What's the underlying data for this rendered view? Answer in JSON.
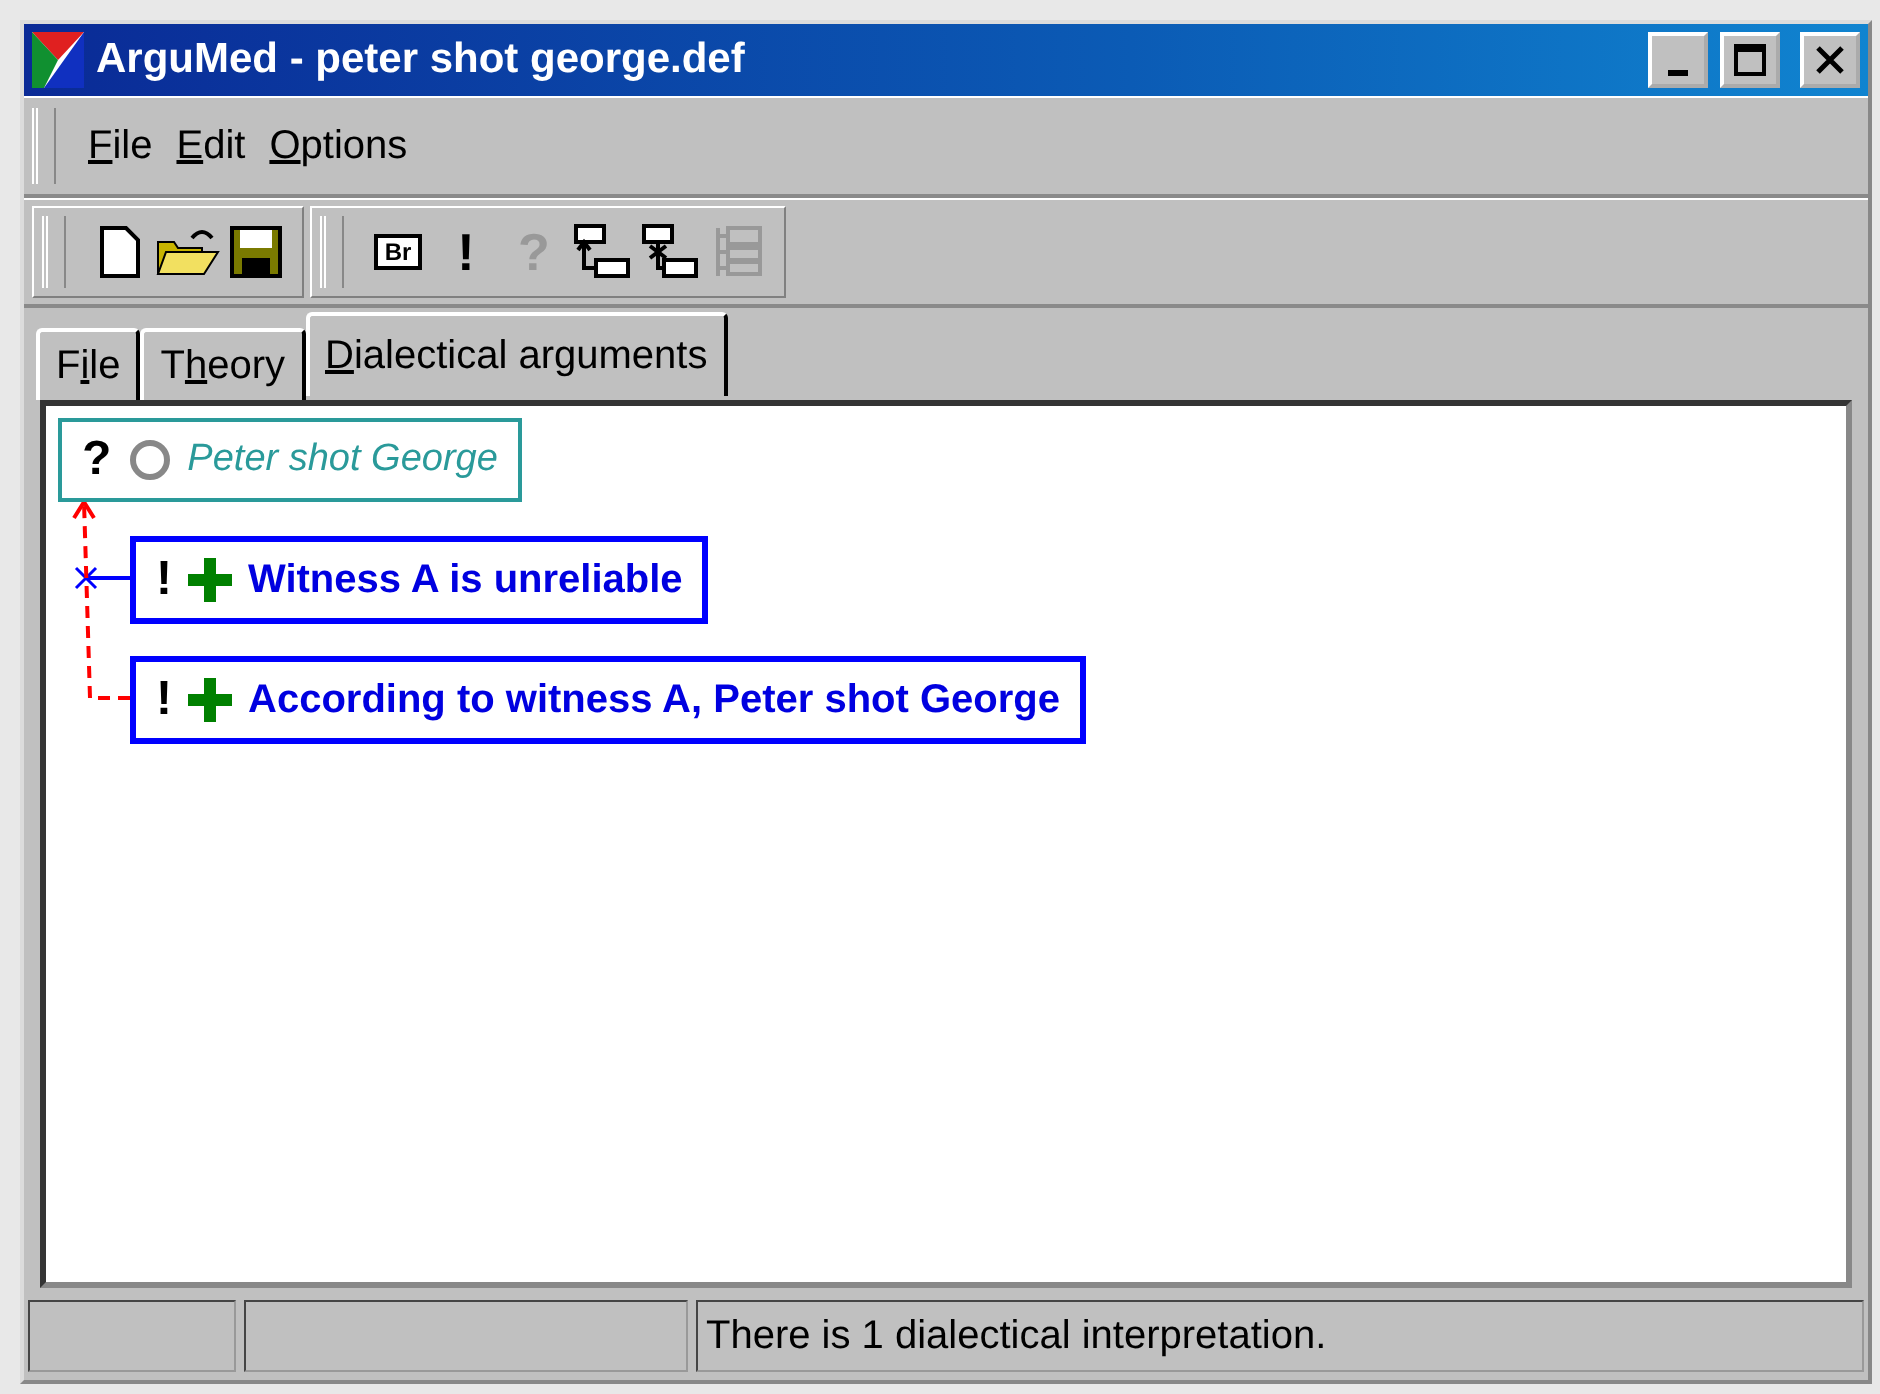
{
  "window": {
    "title": "ArguMed - peter shot george.def"
  },
  "menu": [
    {
      "key": "F",
      "after": "ile"
    },
    {
      "key": "E",
      "after": "dit"
    },
    {
      "key": "O",
      "after": "ptions"
    }
  ],
  "toolbar": [
    {
      "items": [
        {
          "kind": "new",
          "disabled": false
        },
        {
          "kind": "open",
          "disabled": false
        },
        {
          "kind": "save",
          "disabled": false
        }
      ]
    },
    {
      "items": [
        {
          "kind": "boxed-text",
          "label": "Br",
          "disabled": false
        },
        {
          "kind": "text",
          "label": "!",
          "disabled": false
        },
        {
          "kind": "text",
          "label": "?",
          "disabled": true
        },
        {
          "kind": "tree-up",
          "disabled": false
        },
        {
          "kind": "tree-down",
          "disabled": false
        },
        {
          "kind": "tree-list",
          "disabled": true
        }
      ]
    }
  ],
  "tabs": [
    {
      "before": "F",
      "key": "i",
      "after": "le",
      "selected": false
    },
    {
      "before": "T",
      "key": "h",
      "after": "eory",
      "selected": false
    },
    {
      "key": "D",
      "after": "ialectical arguments",
      "selected": true
    }
  ],
  "nodes": [
    {
      "kind": "issue",
      "status": "?",
      "label": "Peter shot George"
    },
    {
      "kind": "accepted",
      "status": "!",
      "label": "Witness A is unreliable",
      "connector": {
        "kind": "undercut"
      }
    },
    {
      "kind": "accepted",
      "status": "!",
      "label": "According to witness A, Peter shot George",
      "connector": {
        "kind": "support"
      }
    }
  ],
  "status_bar": {
    "panels": [
      {
        "kind": "empty"
      },
      {
        "kind": "empty"
      },
      {
        "kind": "text",
        "text": "There is 1 dialectical interpretation."
      }
    ]
  }
}
